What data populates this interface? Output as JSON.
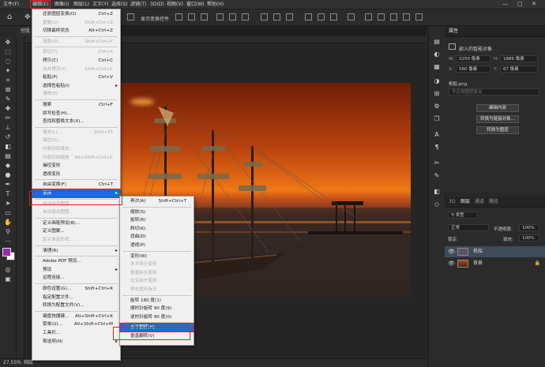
{
  "menubar": {
    "items": [
      "文件(F)",
      "编辑(E)",
      "图像(I)",
      "图层(L)",
      "文字(Y)",
      "选择(S)",
      "滤镜(T)",
      "3D(D)",
      "视图(V)",
      "窗口(W)",
      "帮助(H)"
    ],
    "window_controls": [
      "—",
      "□",
      "✕"
    ]
  },
  "options_bar": {
    "transform_controls": "显示变换控件"
  },
  "document_tab": "穷肌",
  "status": {
    "zoom": "27.55%",
    "info": "纯绘"
  },
  "edit_menu": {
    "items": [
      {
        "label": "还原图层变换(O)",
        "shortcut": "Ctrl+Z",
        "disabled": false
      },
      {
        "label": "重做(O)",
        "shortcut": "Shift+Ctrl+Z",
        "disabled": true
      },
      {
        "label": "切换最终状态",
        "shortcut": "Alt+Ctrl+Z",
        "disabled": false
      },
      {
        "label": "渐隐(D)...",
        "shortcut": "Shift+Ctrl+F",
        "disabled": true
      },
      {
        "label": "剪切(T)",
        "shortcut": "Ctrl+X",
        "disabled": true
      },
      {
        "label": "拷贝(C)",
        "shortcut": "Ctrl+C",
        "disabled": false
      },
      {
        "label": "合并拷贝(Y)",
        "shortcut": "Shift+Ctrl+C",
        "disabled": true
      },
      {
        "label": "粘贴(P)",
        "shortcut": "Ctrl+V",
        "disabled": false
      },
      {
        "label": "选择性粘贴(I)",
        "shortcut": "",
        "disabled": false,
        "submenu": true
      },
      {
        "label": "清除(E)",
        "shortcut": "",
        "disabled": true
      },
      {
        "label": "搜索",
        "shortcut": "Ctrl+F",
        "disabled": false
      },
      {
        "label": "拼写检查(H)...",
        "shortcut": "",
        "disabled": false
      },
      {
        "label": "查找和替换文本(X)...",
        "shortcut": "",
        "disabled": false
      },
      {
        "label": "填充(L)...",
        "shortcut": "Shift+F5",
        "disabled": true
      },
      {
        "label": "描边(S)...",
        "shortcut": "",
        "disabled": true
      },
      {
        "label": "内容识别填充...",
        "shortcut": "",
        "disabled": true
      },
      {
        "label": "内容识别缩放",
        "shortcut": "Alt+Shift+Ctrl+C",
        "disabled": true
      },
      {
        "label": "操控变形",
        "shortcut": "",
        "disabled": false
      },
      {
        "label": "透视变形",
        "shortcut": "",
        "disabled": false
      },
      {
        "label": "自由变换(F)",
        "shortcut": "Ctrl+T",
        "disabled": false
      },
      {
        "label": "变换",
        "shortcut": "",
        "disabled": false,
        "submenu": true,
        "highlight": true
      },
      {
        "label": "自动对齐图层...",
        "shortcut": "",
        "disabled": true
      },
      {
        "label": "自动混合图层...",
        "shortcut": "",
        "disabled": true
      },
      {
        "label": "定义画笔预设(B)...",
        "shortcut": "",
        "disabled": false
      },
      {
        "label": "定义图案...",
        "shortcut": "",
        "disabled": false
      },
      {
        "label": "定义自定形状...",
        "shortcut": "",
        "disabled": true
      },
      {
        "label": "清理(R)",
        "shortcut": "",
        "disabled": false,
        "submenu": true
      },
      {
        "label": "Adobe PDF 预设...",
        "shortcut": "",
        "disabled": false
      },
      {
        "label": "预设",
        "shortcut": "",
        "disabled": false,
        "submenu": true
      },
      {
        "label": "远程连接...",
        "shortcut": "",
        "disabled": false
      },
      {
        "label": "颜色设置(G)...",
        "shortcut": "Shift+Ctrl+K",
        "disabled": false
      },
      {
        "label": "指定配置文件...",
        "shortcut": "",
        "disabled": false
      },
      {
        "label": "转换为配置文件(V)...",
        "shortcut": "",
        "disabled": false
      },
      {
        "label": "键盘快捷键...",
        "shortcut": "Alt+Shift+Ctrl+K",
        "disabled": false
      },
      {
        "label": "菜单(U)...",
        "shortcut": "Alt+Shift+Ctrl+M",
        "disabled": false
      },
      {
        "label": "工具栏...",
        "shortcut": "",
        "disabled": false
      },
      {
        "label": "首选项(N)",
        "shortcut": "",
        "disabled": false,
        "submenu": true
      }
    ]
  },
  "transform_submenu": {
    "items": [
      {
        "label": "再次(A)",
        "shortcut": "Shift+Ctrl+T",
        "disabled": false
      },
      {
        "label": "缩放(S)",
        "disabled": false
      },
      {
        "label": "旋转(R)",
        "disabled": false
      },
      {
        "label": "斜切(K)",
        "disabled": false
      },
      {
        "label": "扭曲(D)",
        "disabled": false
      },
      {
        "label": "透视(P)",
        "disabled": false
      },
      {
        "label": "变形(W)",
        "disabled": false
      },
      {
        "label": "水平拆分变形",
        "disabled": true
      },
      {
        "label": "垂直拆分变形",
        "disabled": true
      },
      {
        "label": "交叉拆分变形",
        "disabled": true
      },
      {
        "label": "移去变形拆分",
        "disabled": true
      },
      {
        "label": "旋转 180 度(1)",
        "disabled": false
      },
      {
        "label": "顺时针旋转 90 度(9)",
        "disabled": false
      },
      {
        "label": "逆时针旋转 90 度(0)",
        "disabled": false
      },
      {
        "label": "水平翻转(H)",
        "disabled": false,
        "highlight": true
      },
      {
        "label": "垂直翻转(V)",
        "disabled": false
      }
    ]
  },
  "properties_panel": {
    "title": "属性",
    "type": "嵌入的智能对象",
    "w_label": "W:",
    "w_value": "2259 像素",
    "h_label": "H:",
    "h_value": "1886 像素",
    "x_label": "X:",
    "x_value": "580 像素",
    "y_label": "Y:",
    "y_value": "67 像素",
    "file": "帆船.png",
    "comps": "不应用图层复合",
    "btn_edit": "编辑内容",
    "btn_convert_linked": "转换为链接对象...",
    "btn_convert_layers": "转换为图层"
  },
  "layers_panel": {
    "tabs": [
      "3D",
      "图层",
      "通道",
      "路径"
    ],
    "kind_filter": "类型",
    "blend_mode": "正常",
    "opacity_label": "不透明度:",
    "opacity": "100%",
    "lock_label": "锁定:",
    "fill_label": "填充:",
    "fill": "100%",
    "layers": [
      {
        "name": "帆船",
        "selected": true
      },
      {
        "name": "背景",
        "selected": false
      }
    ]
  },
  "colors": {
    "foreground": "#9c27b0",
    "background": "#ffffff",
    "highlight": "#1f6cd4",
    "annotation": "#e02020"
  }
}
